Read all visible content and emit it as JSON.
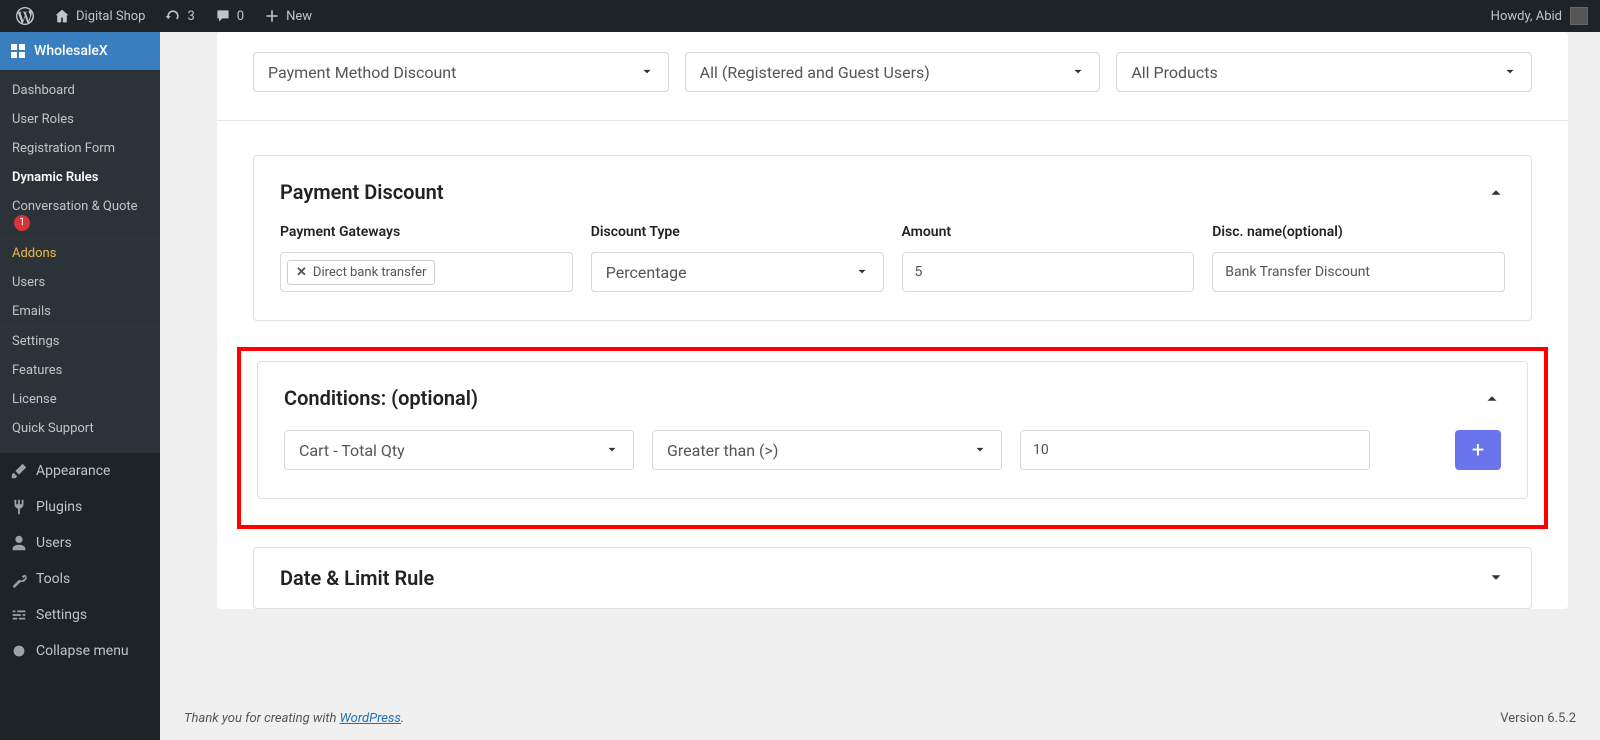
{
  "adminbar": {
    "site_name": "Digital Shop",
    "updates_count": "3",
    "comments_count": "0",
    "new_label": "New",
    "howdy": "Howdy, Abid"
  },
  "sidebar": {
    "plugin_name": "WholesaleX",
    "items": [
      {
        "label": "Dashboard"
      },
      {
        "label": "User Roles"
      },
      {
        "label": "Registration Form"
      },
      {
        "label": "Dynamic Rules",
        "current": true
      },
      {
        "label": "Conversation & Quote",
        "badge": "1"
      },
      {
        "label": "Addons",
        "gold": true,
        "sep_before": true
      },
      {
        "label": "Users"
      },
      {
        "label": "Emails"
      },
      {
        "label": "Settings",
        "sep_before": true
      },
      {
        "label": "Features"
      },
      {
        "label": "License"
      },
      {
        "label": "Quick Support"
      }
    ],
    "main": [
      {
        "label": "Appearance",
        "icon": "brush"
      },
      {
        "label": "Plugins",
        "icon": "plug"
      },
      {
        "label": "Users",
        "icon": "user"
      },
      {
        "label": "Tools",
        "icon": "wrench"
      },
      {
        "label": "Settings",
        "icon": "sliders"
      },
      {
        "label": "Collapse menu",
        "icon": "collapse"
      }
    ]
  },
  "toprow": {
    "rule_type": "Payment Method Discount",
    "user_scope": "All (Registered and Guest Users)",
    "product_scope": "All Products"
  },
  "payment": {
    "title": "Payment Discount",
    "gateways_label": "Payment Gateways",
    "gateway_chip": "Direct bank transfer",
    "discount_type_label": "Discount Type",
    "discount_type_value": "Percentage",
    "amount_label": "Amount",
    "amount_value": "5",
    "disc_name_label": "Disc. name(optional)",
    "disc_name_value": "Bank Transfer Discount"
  },
  "conditions": {
    "title": "Conditions: (optional)",
    "field": "Cart - Total Qty",
    "operator": "Greater than (>)",
    "value": "10"
  },
  "datelimit": {
    "title": "Date & Limit Rule"
  },
  "footer": {
    "thanks_pre": "Thank you for creating with ",
    "wp_link": "WordPress",
    "thanks_post": ".",
    "version": "Version 6.5.2"
  }
}
